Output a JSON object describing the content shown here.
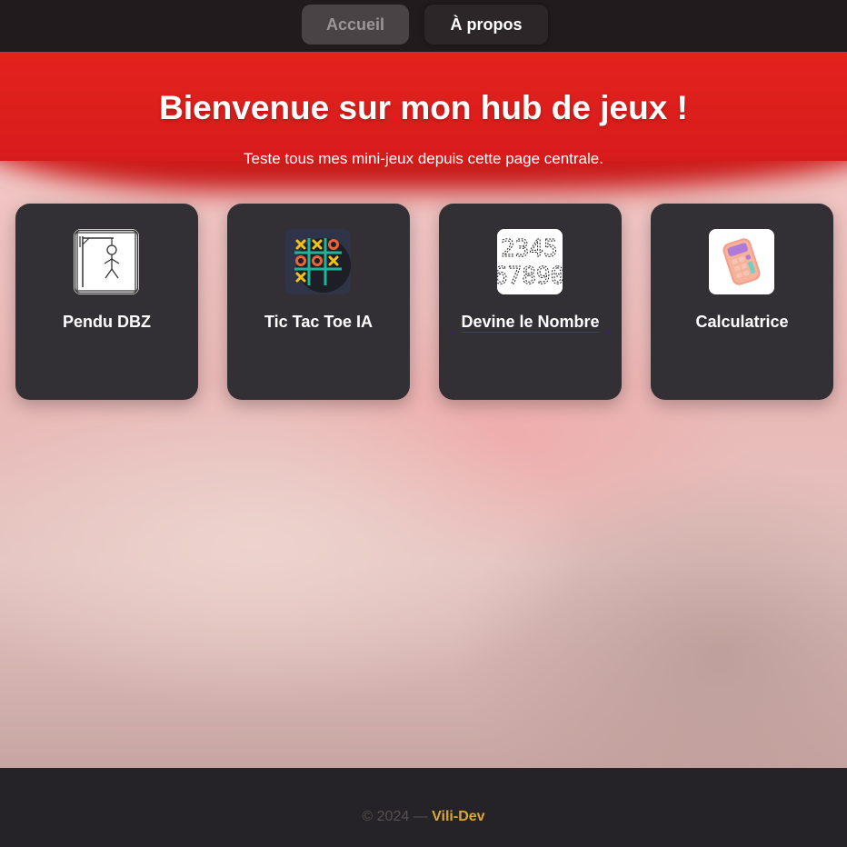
{
  "nav": {
    "home_label": "Accueil",
    "about_label": "À propos"
  },
  "hero": {
    "title": "Bienvenue sur mon hub de jeux !",
    "subtitle": "Teste tous mes mini-jeux depuis cette page centrale."
  },
  "games": [
    {
      "label": "Pendu DBZ",
      "icon": "hangman-icon"
    },
    {
      "label": "Tic Tac Toe IA",
      "icon": "tic-tac-toe-icon"
    },
    {
      "label": "Devine le Nombre",
      "icon": "numbers-icon",
      "digits_top": "2345",
      "digits_bottom": "67890"
    },
    {
      "label": "Calculatrice",
      "icon": "calculator-icon"
    }
  ],
  "footer": {
    "copyright": "© 2024 —",
    "author": "Vili-Dev"
  },
  "colors": {
    "hero_red": "#e3241f",
    "card_bg": "#333035",
    "footer_bg": "#252327",
    "author_gold": "#d9a82e"
  }
}
